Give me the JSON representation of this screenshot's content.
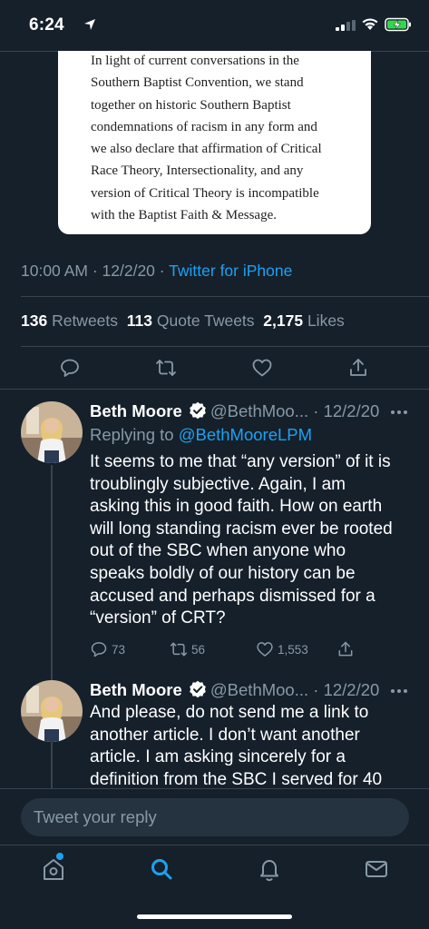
{
  "status_bar": {
    "time": "6:24"
  },
  "quote_card": {
    "lines": [
      "In light of current conversations in the",
      "Southern Baptist Convention, we stand",
      "together on historic Southern Baptist",
      "condemnations of racism in any form and",
      "we also declare that affirmation of Critical",
      "Race Theory, Intersectionality, and any",
      "version of Critical Theory is incompatible",
      "with the Baptist Faith & Message."
    ]
  },
  "tweet_meta": {
    "time": "10:00 AM",
    "date": "12/2/20",
    "separator": "·",
    "client": "Twitter for iPhone"
  },
  "tweet_stats": {
    "retweets_count": "136",
    "retweets_label": "Retweets",
    "quote_count": "113",
    "quote_label": "Quote Tweets",
    "likes_count": "2,175",
    "likes_label": "Likes"
  },
  "replies": [
    {
      "name": "Beth Moore",
      "handle": "@BethMoo...",
      "date": "· 12/2/20",
      "replying_prefix": "Replying to",
      "replying_handle": "@BethMooreLPM",
      "lines": [
        "It seems to me that “any version” of it is",
        "troublingly subjective. Again, I am",
        "asking this in good faith. How on earth",
        "will long standing racism ever be rooted",
        "out of the SBC when anyone who",
        "speaks boldly of our history can be",
        "accused and perhaps dismissed for a",
        "“version” of CRT?"
      ],
      "reply_count": "73",
      "retweet_count": "56",
      "like_count": "1,553"
    },
    {
      "name": "Beth Moore",
      "handle": "@BethMoo...",
      "date": "· 12/2/20",
      "lines": [
        "And please, do not send me a link to",
        "another article. I don’t want another",
        "article. I am asking sincerely for a",
        "definition from the SBC I served for 40"
      ]
    }
  ],
  "composer": {
    "placeholder": "Tweet your reply"
  },
  "colors": {
    "background": "#15202b",
    "accent": "#1da1f2",
    "secondary_text": "#8899a6",
    "divider": "#38444d"
  },
  "icons": [
    "location-arrow-icon",
    "signal-icon",
    "wifi-icon",
    "battery-charging-icon",
    "reply-icon",
    "retweet-icon",
    "like-icon",
    "share-icon",
    "verified-badge-icon",
    "more-icon",
    "home-icon",
    "search-icon",
    "notifications-icon",
    "messages-icon"
  ]
}
